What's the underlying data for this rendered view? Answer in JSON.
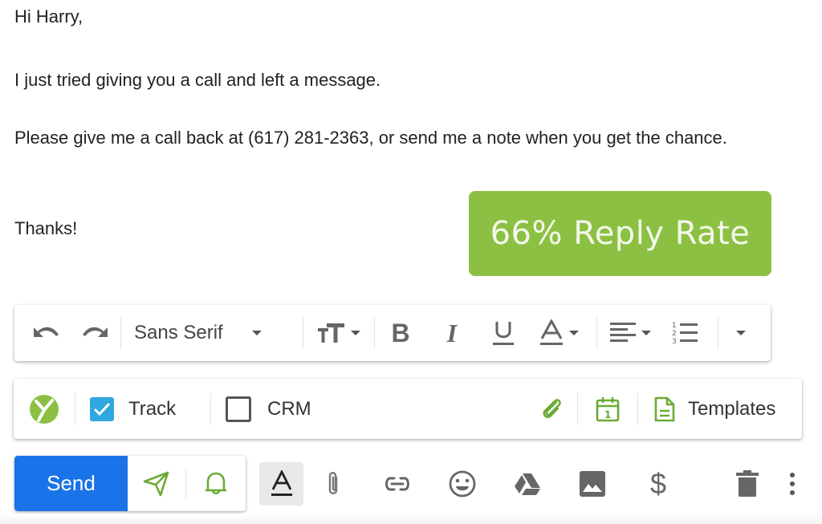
{
  "email": {
    "greeting": "Hi Harry,",
    "paragraphs": [
      "I just tried giving you a call and left a message.",
      "Please give me a call back at (617) 281-2363, or send me a note when you get the chance."
    ],
    "signoff": "Thanks!"
  },
  "badge": {
    "text": "66% Reply Rate",
    "color": "#8cc043"
  },
  "format_toolbar": {
    "font_family": "Sans Serif",
    "icons": [
      "undo-icon",
      "redo-icon",
      "font-size-icon",
      "bold-icon",
      "italic-icon",
      "underline-icon",
      "text-color-icon",
      "align-icon",
      "numbered-list-icon",
      "more-formatting-icon"
    ]
  },
  "addon_toolbar": {
    "track_label": "Track",
    "track_checked": true,
    "crm_label": "CRM",
    "crm_checked": false,
    "templates_label": "Templates",
    "accent_color": "#6aaa35"
  },
  "bottom_toolbar": {
    "send_label": "Send",
    "send_color": "#1a73e8",
    "icons": [
      "send-later-icon",
      "reminder-bell-icon",
      "formatting-options-icon",
      "attach-icon",
      "link-icon",
      "emoji-icon",
      "drive-icon",
      "photo-icon",
      "dollar-icon",
      "trash-icon",
      "more-options-icon"
    ]
  }
}
